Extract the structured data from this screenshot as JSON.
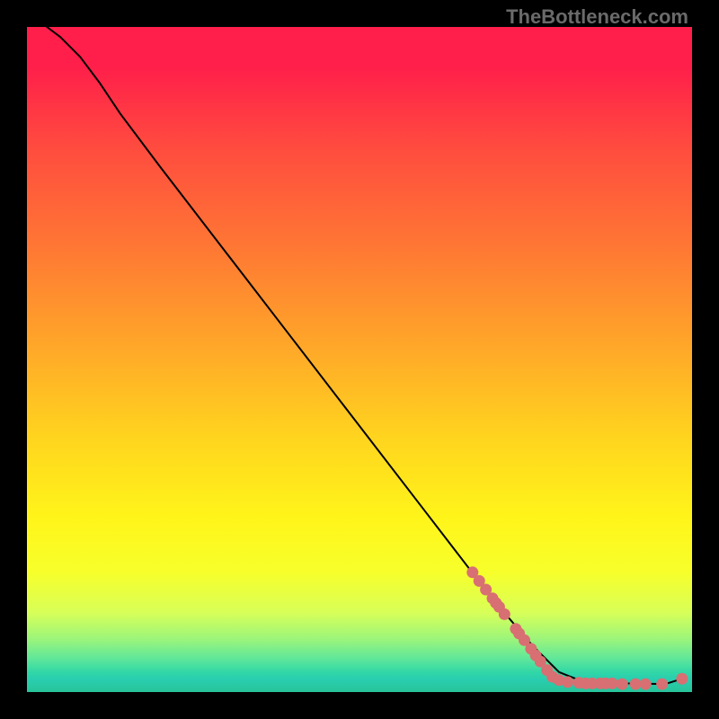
{
  "watermark": "TheBottleneck.com",
  "chart_data": {
    "type": "line",
    "title": "",
    "xlabel": "",
    "ylabel": "",
    "xlim": [
      0,
      1
    ],
    "ylim": [
      0,
      1
    ],
    "curve": [
      {
        "x": 0.03,
        "y": 1.0
      },
      {
        "x": 0.05,
        "y": 0.985
      },
      {
        "x": 0.08,
        "y": 0.955
      },
      {
        "x": 0.11,
        "y": 0.915
      },
      {
        "x": 0.14,
        "y": 0.87
      },
      {
        "x": 0.2,
        "y": 0.79
      },
      {
        "x": 0.3,
        "y": 0.66
      },
      {
        "x": 0.4,
        "y": 0.53
      },
      {
        "x": 0.5,
        "y": 0.4
      },
      {
        "x": 0.6,
        "y": 0.27
      },
      {
        "x": 0.7,
        "y": 0.14
      },
      {
        "x": 0.76,
        "y": 0.07
      },
      {
        "x": 0.8,
        "y": 0.03
      },
      {
        "x": 0.83,
        "y": 0.018
      },
      {
        "x": 0.9,
        "y": 0.013
      },
      {
        "x": 0.96,
        "y": 0.012
      },
      {
        "x": 0.985,
        "y": 0.02
      }
    ],
    "highlight_points": [
      {
        "x": 0.67,
        "y": 0.18
      },
      {
        "x": 0.68,
        "y": 0.167
      },
      {
        "x": 0.69,
        "y": 0.154
      },
      {
        "x": 0.7,
        "y": 0.141
      },
      {
        "x": 0.705,
        "y": 0.134
      },
      {
        "x": 0.71,
        "y": 0.128
      },
      {
        "x": 0.718,
        "y": 0.117
      },
      {
        "x": 0.735,
        "y": 0.095
      },
      {
        "x": 0.74,
        "y": 0.088
      },
      {
        "x": 0.748,
        "y": 0.078
      },
      {
        "x": 0.758,
        "y": 0.065
      },
      {
        "x": 0.765,
        "y": 0.055
      },
      {
        "x": 0.772,
        "y": 0.046
      },
      {
        "x": 0.782,
        "y": 0.033
      },
      {
        "x": 0.79,
        "y": 0.023
      },
      {
        "x": 0.8,
        "y": 0.018
      },
      {
        "x": 0.813,
        "y": 0.015
      },
      {
        "x": 0.83,
        "y": 0.014
      },
      {
        "x": 0.84,
        "y": 0.013
      },
      {
        "x": 0.85,
        "y": 0.013
      },
      {
        "x": 0.862,
        "y": 0.013
      },
      {
        "x": 0.87,
        "y": 0.013
      },
      {
        "x": 0.88,
        "y": 0.013
      },
      {
        "x": 0.895,
        "y": 0.012
      },
      {
        "x": 0.915,
        "y": 0.012
      },
      {
        "x": 0.93,
        "y": 0.012
      },
      {
        "x": 0.955,
        "y": 0.012
      },
      {
        "x": 0.985,
        "y": 0.02
      }
    ],
    "marker_color": "#d86f72",
    "line_color": "#000000"
  }
}
